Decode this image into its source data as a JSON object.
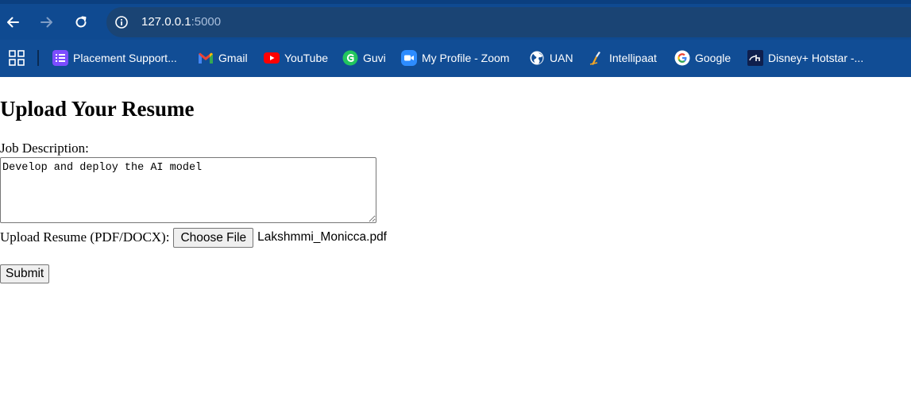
{
  "browser": {
    "url_host": "127.0.0.1",
    "url_port": ":5000",
    "colors": {
      "chrome": "#114d95",
      "omnibox": "#1a4474"
    },
    "icons": {
      "back": "arrow-left-icon",
      "forward": "arrow-right-icon",
      "reload": "reload-icon",
      "site_info": "info-circle-icon",
      "apps": "apps-grid-icon"
    },
    "bookmarks": [
      {
        "label": "Placement Support...",
        "icon": "placement-support-favicon",
        "color": "#7c4dff"
      },
      {
        "label": "Gmail",
        "icon": "gmail-favicon",
        "color": "#ea4335"
      },
      {
        "label": "YouTube",
        "icon": "youtube-favicon",
        "color": "#ff0000"
      },
      {
        "label": "Guvi",
        "icon": "guvi-favicon",
        "color": "#22c55e"
      },
      {
        "label": "My Profile - Zoom",
        "icon": "zoom-favicon",
        "color": "#2d8cff"
      },
      {
        "label": "UAN",
        "icon": "globe-favicon",
        "color": "#ffffff"
      },
      {
        "label": "Intellipaat",
        "icon": "intellipaat-favicon",
        "color": "#f5a623"
      },
      {
        "label": "Google",
        "icon": "google-favicon",
        "color": "#4285f4"
      },
      {
        "label": "Disney+ Hotstar -...",
        "icon": "hotstar-favicon",
        "color": "#0f1f4d"
      }
    ]
  },
  "page": {
    "title": "Upload Your Resume",
    "job_description_label": "Job Description:",
    "job_description_value": "Develop and deploy the AI model",
    "upload_label": "Upload Resume (PDF/DOCX):",
    "choose_file_label": "Choose File",
    "selected_file": "Lakshmmi_Monicca.pdf",
    "submit_label": "Submit"
  }
}
